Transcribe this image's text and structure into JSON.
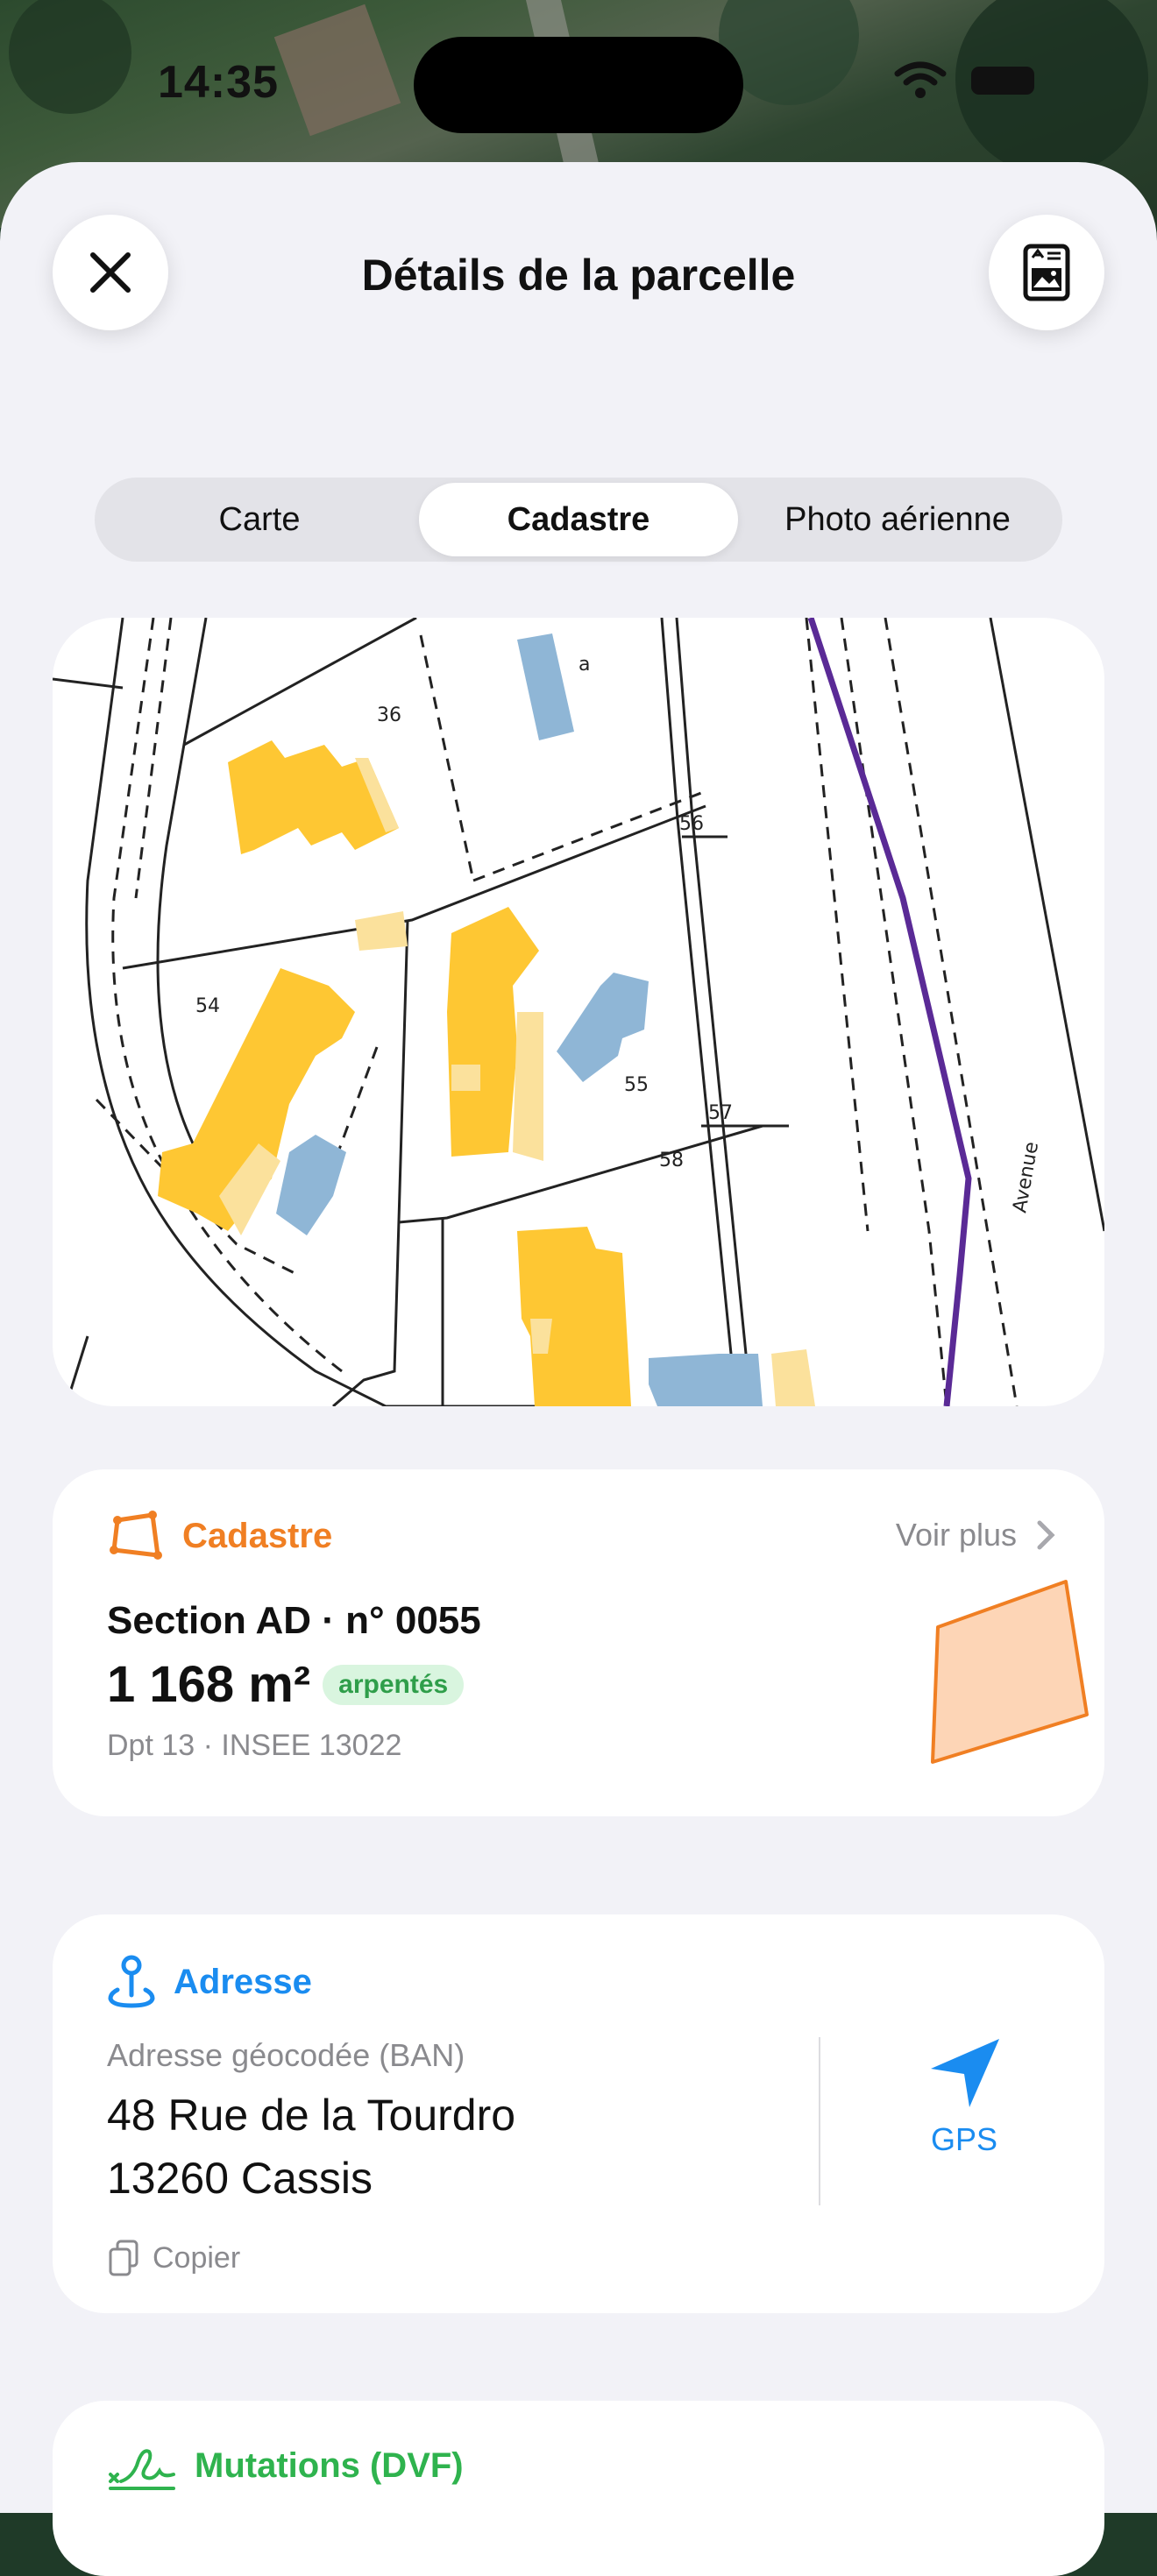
{
  "status_bar": {
    "time": "14:35"
  },
  "header": {
    "title": "Détails de la parcelle"
  },
  "segmented": {
    "tabs": [
      "Carte",
      "Cadastre",
      "Photo aérienne"
    ],
    "selected": "Cadastre"
  },
  "map": {
    "parcel_numbers": [
      "36",
      "54",
      "55",
      "56",
      "57",
      "58"
    ],
    "street_label": "Avenue",
    "small_label": "a"
  },
  "cadastre": {
    "heading": "Cadastre",
    "see_more": "Voir plus",
    "section": "Section AD · n° 0055",
    "area": "1 168 m²",
    "badge": "arpentés",
    "meta": "Dpt 13 · INSEE 13022",
    "color": "#f07f23"
  },
  "address": {
    "heading": "Adresse",
    "label": "Adresse géocodée (BAN)",
    "line1": "48 Rue de la Tourdro",
    "line2": "13260 Cassis",
    "copy": "Copier",
    "gps": "GPS",
    "color": "#1a8cf0"
  },
  "mutations": {
    "heading": "Mutations (DVF)",
    "color": "#2fb34e"
  }
}
